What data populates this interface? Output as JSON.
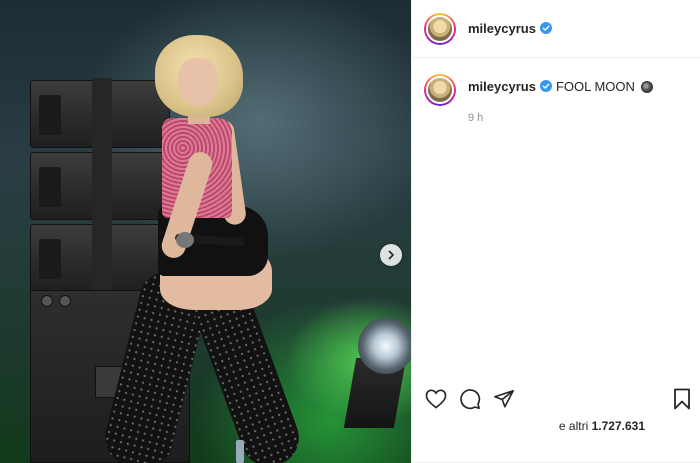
{
  "post": {
    "username": "mileycyrus",
    "verified_icon": "verified-badge-icon",
    "caption": "FOOL MOON",
    "caption_emoji_icon": "new-moon-icon",
    "time_ago": "9 h",
    "likes_prefix": "e altri",
    "likes_count": "1.727.631"
  },
  "media": {
    "next_icon": "chevron-right-icon"
  },
  "actions": {
    "like_icon": "heart-icon",
    "comment_icon": "comment-icon",
    "share_icon": "paper-plane-icon",
    "save_icon": "bookmark-icon"
  },
  "colors": {
    "verified": "#3897f0",
    "text": "#262626",
    "muted": "#8e8e8e",
    "border": "#efefef"
  }
}
